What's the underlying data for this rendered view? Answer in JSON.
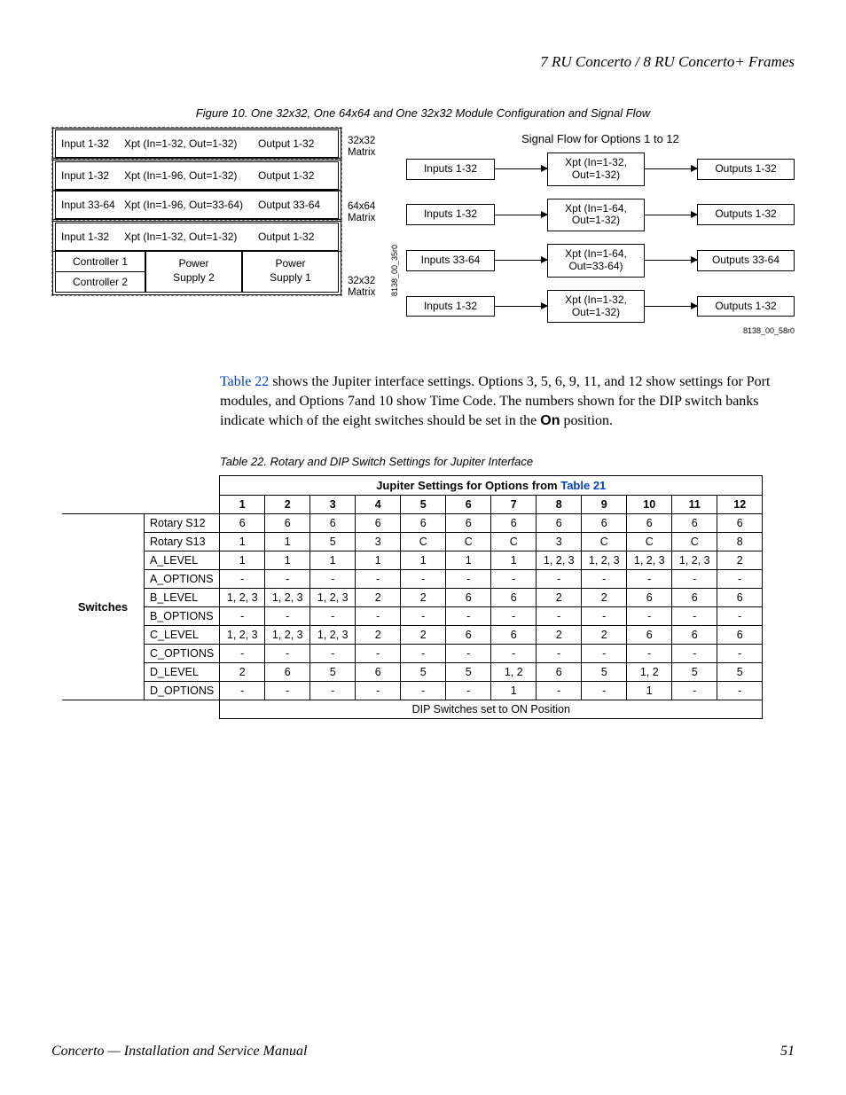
{
  "header": "7 RU Concerto / 8 RU Concerto+ Frames",
  "figure_caption": "Figure 10.  One 32x32, One 64x64 and One 32x32 Module Configuration and Signal Flow",
  "left_diagram": {
    "rows": [
      {
        "in": "Input 1-32",
        "xpt": "Xpt (In=1-32, Out=1-32)",
        "out": "Output 1-32",
        "matrix": "32x32\nMatrix"
      },
      {
        "in": "Input 1-32",
        "xpt": "Xpt (In=1-96, Out=1-32)",
        "out": "Output 1-32"
      },
      {
        "in": "Input 33-64",
        "xpt": "Xpt (In=1-96, Out=33-64)",
        "out": "Output 33-64",
        "matrix": "64x64\nMatrix"
      },
      {
        "in": "Input 1-32",
        "xpt": "Xpt (In=1-32, Out=1-32)",
        "out": "Output 1-32",
        "matrix": "32x32\nMatrix"
      }
    ],
    "ctrl1": "Controller 1",
    "ctrl2": "Controller 2",
    "pwr2": "Power\nSupply 2",
    "pwr1": "Power\nSupply 1",
    "id": "8138_00_35r0"
  },
  "right_diagram": {
    "title": "Signal Flow for Options 1 to 12",
    "rows": [
      {
        "in": "Inputs 1-32",
        "xpt_a": "Xpt (In=1-32,",
        "xpt_b": "Out=1-32)",
        "out": "Outputs 1-32"
      },
      {
        "in": "Inputs 1-32",
        "xpt_a": "Xpt (In=1-64,",
        "xpt_b": "Out=1-32)",
        "out": "Outputs 1-32"
      },
      {
        "in": "Inputs 33-64",
        "xpt_a": "Xpt (In=1-64,",
        "xpt_b": "Out=33-64)",
        "out": "Outputs 33-64"
      },
      {
        "in": "Inputs 1-32",
        "xpt_a": "Xpt (In=1-32,",
        "xpt_b": "Out=1-32)",
        "out": "Outputs 1-32"
      }
    ],
    "id": "8138_00_58r0"
  },
  "paragraph": {
    "link1": "Table 22",
    "t1": " shows the Jupiter interface settings. Options 3, 5, 6, 9, 11, and 12 show settings for Port modules, and Options 7and 10 show Time Code. The numbers shown for the DIP switch banks indicate which of the eight switches should be set in the ",
    "on": "On",
    "t2": " position."
  },
  "table_caption": "Table 22.  Rotary and DIP Switch Settings for Jupiter Interface",
  "table": {
    "top_header_a": "Jupiter Settings for Options from ",
    "top_header_link": "Table 21",
    "cols": [
      "1",
      "2",
      "3",
      "4",
      "5",
      "6",
      "7",
      "8",
      "9",
      "10",
      "11",
      "12"
    ],
    "side": "Switches",
    "rows": [
      {
        "name": "Rotary S12",
        "v": [
          "6",
          "6",
          "6",
          "6",
          "6",
          "6",
          "6",
          "6",
          "6",
          "6",
          "6",
          "6"
        ]
      },
      {
        "name": "Rotary S13",
        "v": [
          "1",
          "1",
          "5",
          "3",
          "C",
          "C",
          "C",
          "3",
          "C",
          "C",
          "C",
          "8"
        ]
      },
      {
        "name": "A_LEVEL",
        "v": [
          "1",
          "1",
          "1",
          "1",
          "1",
          "1",
          "1",
          "1, 2, 3",
          "1, 2, 3",
          "1, 2, 3",
          "1, 2, 3",
          "2"
        ]
      },
      {
        "name": "A_OPTIONS",
        "v": [
          "-",
          "-",
          "-",
          "-",
          "-",
          "-",
          "-",
          "-",
          "-",
          "-",
          "-",
          "-"
        ]
      },
      {
        "name": "B_LEVEL",
        "v": [
          "1, 2, 3",
          "1, 2, 3",
          "1, 2, 3",
          "2",
          "2",
          "6",
          "6",
          "2",
          "2",
          "6",
          "6",
          "6"
        ]
      },
      {
        "name": "B_OPTIONS",
        "v": [
          "-",
          "-",
          "-",
          "-",
          "-",
          "-",
          "-",
          "-",
          "-",
          "-",
          "-",
          "-"
        ]
      },
      {
        "name": "C_LEVEL",
        "v": [
          "1, 2, 3",
          "1, 2, 3",
          "1, 2, 3",
          "2",
          "2",
          "6",
          "6",
          "2",
          "2",
          "6",
          "6",
          "6"
        ]
      },
      {
        "name": "C_OPTIONS",
        "v": [
          "-",
          "-",
          "-",
          "-",
          "-",
          "-",
          "-",
          "-",
          "-",
          "-",
          "-",
          "-"
        ]
      },
      {
        "name": "D_LEVEL",
        "v": [
          "2",
          "6",
          "5",
          "6",
          "5",
          "5",
          "1, 2",
          "6",
          "5",
          "1, 2",
          "5",
          "5"
        ]
      },
      {
        "name": "D_OPTIONS",
        "v": [
          "-",
          "-",
          "-",
          "-",
          "-",
          "-",
          "1",
          "-",
          "-",
          "1",
          "-",
          "-"
        ]
      }
    ],
    "footer": "DIP Switches set to ON Position"
  },
  "footer_left": "Concerto  —  Installation and Service Manual",
  "footer_right": "51"
}
